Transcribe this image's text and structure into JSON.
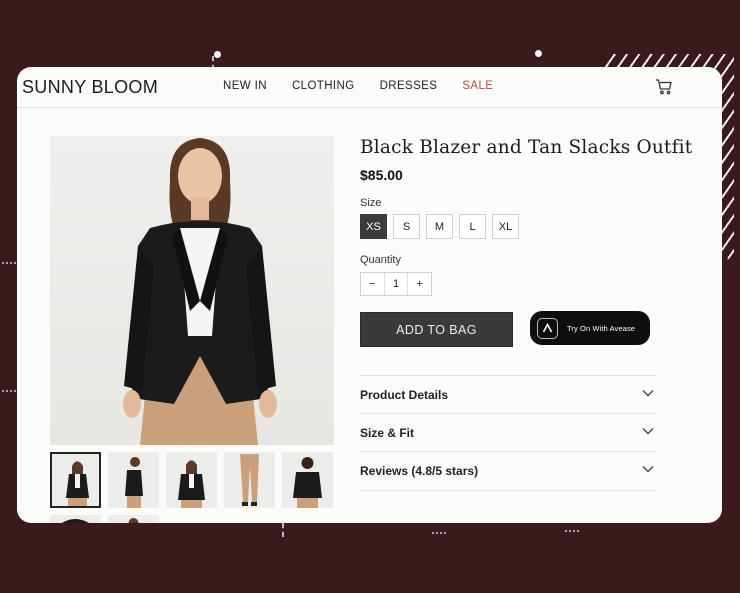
{
  "header": {
    "logo": "SUNNY BLOOM",
    "nav": [
      "NEW IN",
      "CLOTHING",
      "DRESSES",
      "SALE"
    ],
    "cart_icon": "cart-icon"
  },
  "product": {
    "title": "Black Blazer and Tan Slacks Outfit",
    "price": "$85.00",
    "size_label": "Size",
    "sizes": [
      "XS",
      "S",
      "M",
      "L",
      "XL"
    ],
    "selected_size": "XS",
    "quantity_label": "Quantity",
    "quantity_minus": "−",
    "quantity": "1",
    "quantity_plus": "+",
    "add_to_bag": "ADD TO BAG",
    "try_on": "Try On With Avease"
  },
  "accordion": [
    {
      "label": "Product Details"
    },
    {
      "label": "Size & Fit"
    },
    {
      "label": "Reviews (4.8/5 stars)"
    }
  ],
  "colors": {
    "background": "#3a1a1c",
    "accent_sale": "#b44a44",
    "button_dark": "#3a3a3a"
  }
}
